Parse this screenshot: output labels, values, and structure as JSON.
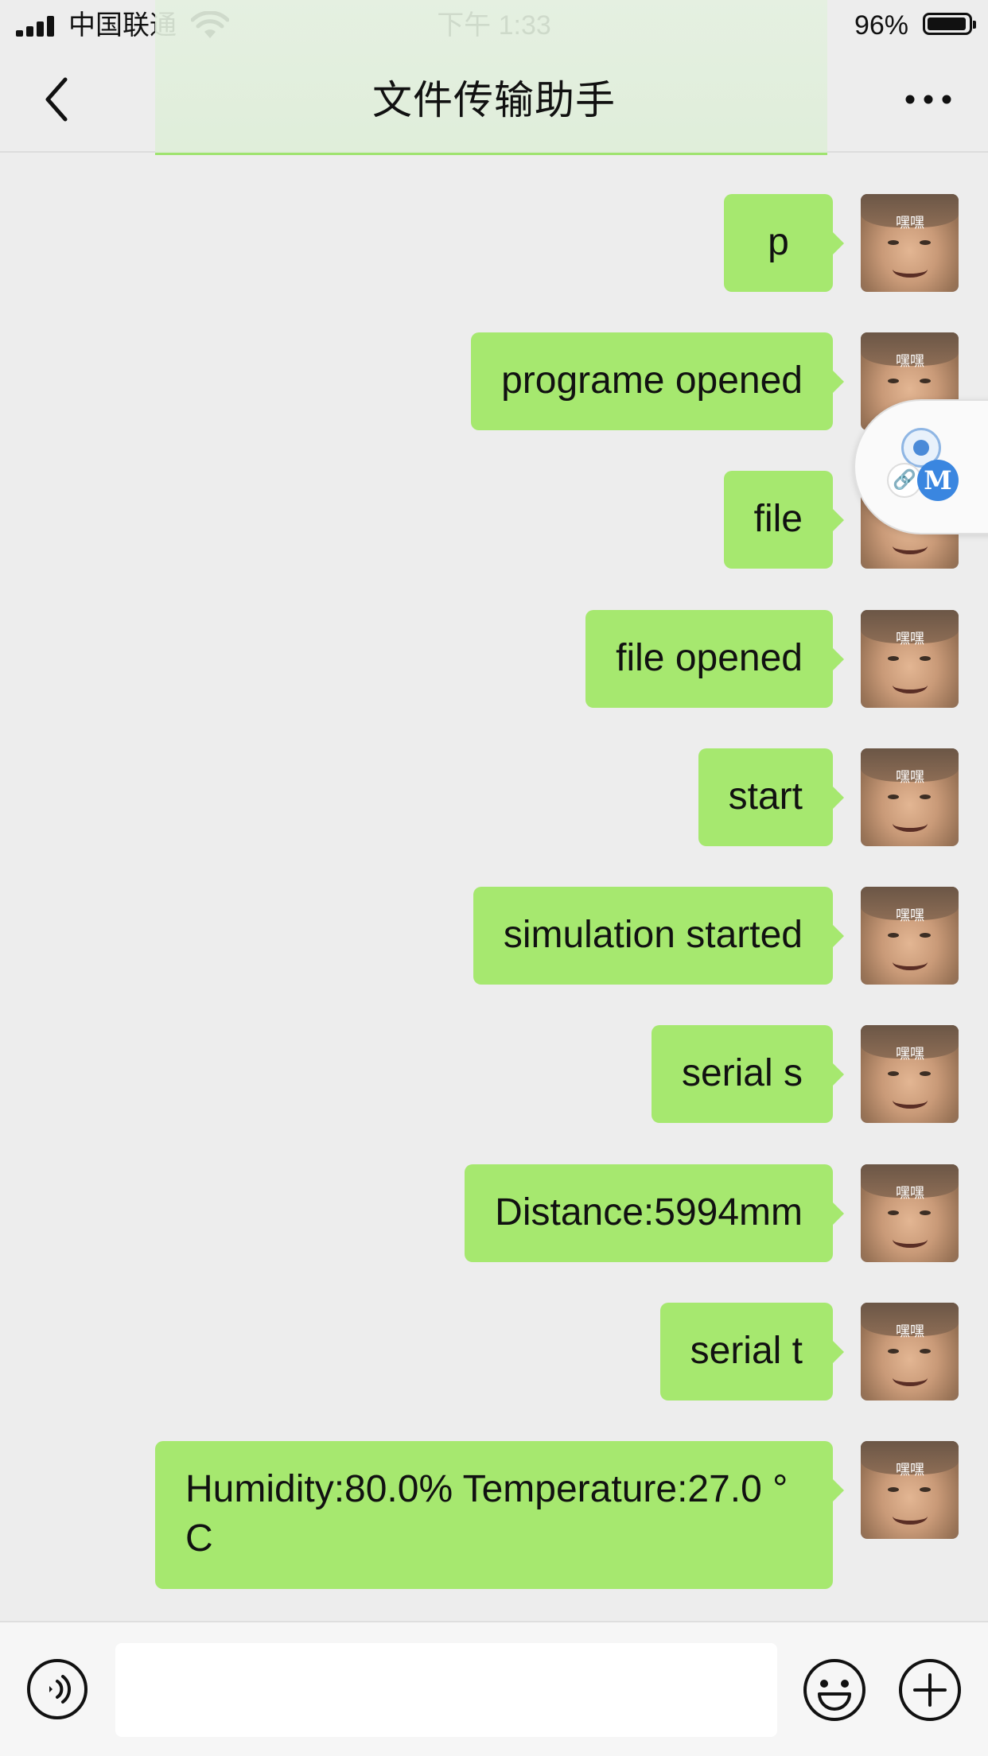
{
  "status_bar": {
    "carrier": "中国联通",
    "time": "下午 1:33",
    "battery_percent": "96%",
    "battery_level": 0.96
  },
  "nav": {
    "title": "文件传输助手",
    "back_icon": "chevron-left-icon",
    "more_icon": "more-horizontal-icon"
  },
  "avatar": {
    "tag": "嘿嘿"
  },
  "messages": [
    {
      "text": "p"
    },
    {
      "text": "programe opened"
    },
    {
      "text": "file"
    },
    {
      "text": "file opened"
    },
    {
      "text": "start"
    },
    {
      "text": "simulation started"
    },
    {
      "text": "serial s"
    },
    {
      "text": "Distance:5994mm"
    },
    {
      "text": "serial t"
    },
    {
      "text": "Humidity:80.0% Temperature:27.0 °C"
    }
  ],
  "floating_widget": {
    "badge_letter": "M",
    "link_glyph": "🔗"
  },
  "input_bar": {
    "placeholder": "",
    "voice_icon": "voice-icon",
    "emoji_icon": "emoji-icon",
    "plus_icon": "plus-icon"
  },
  "colors": {
    "bubble": "#a6e86f",
    "background": "#ededed",
    "accent_blue": "#3a86e0"
  }
}
